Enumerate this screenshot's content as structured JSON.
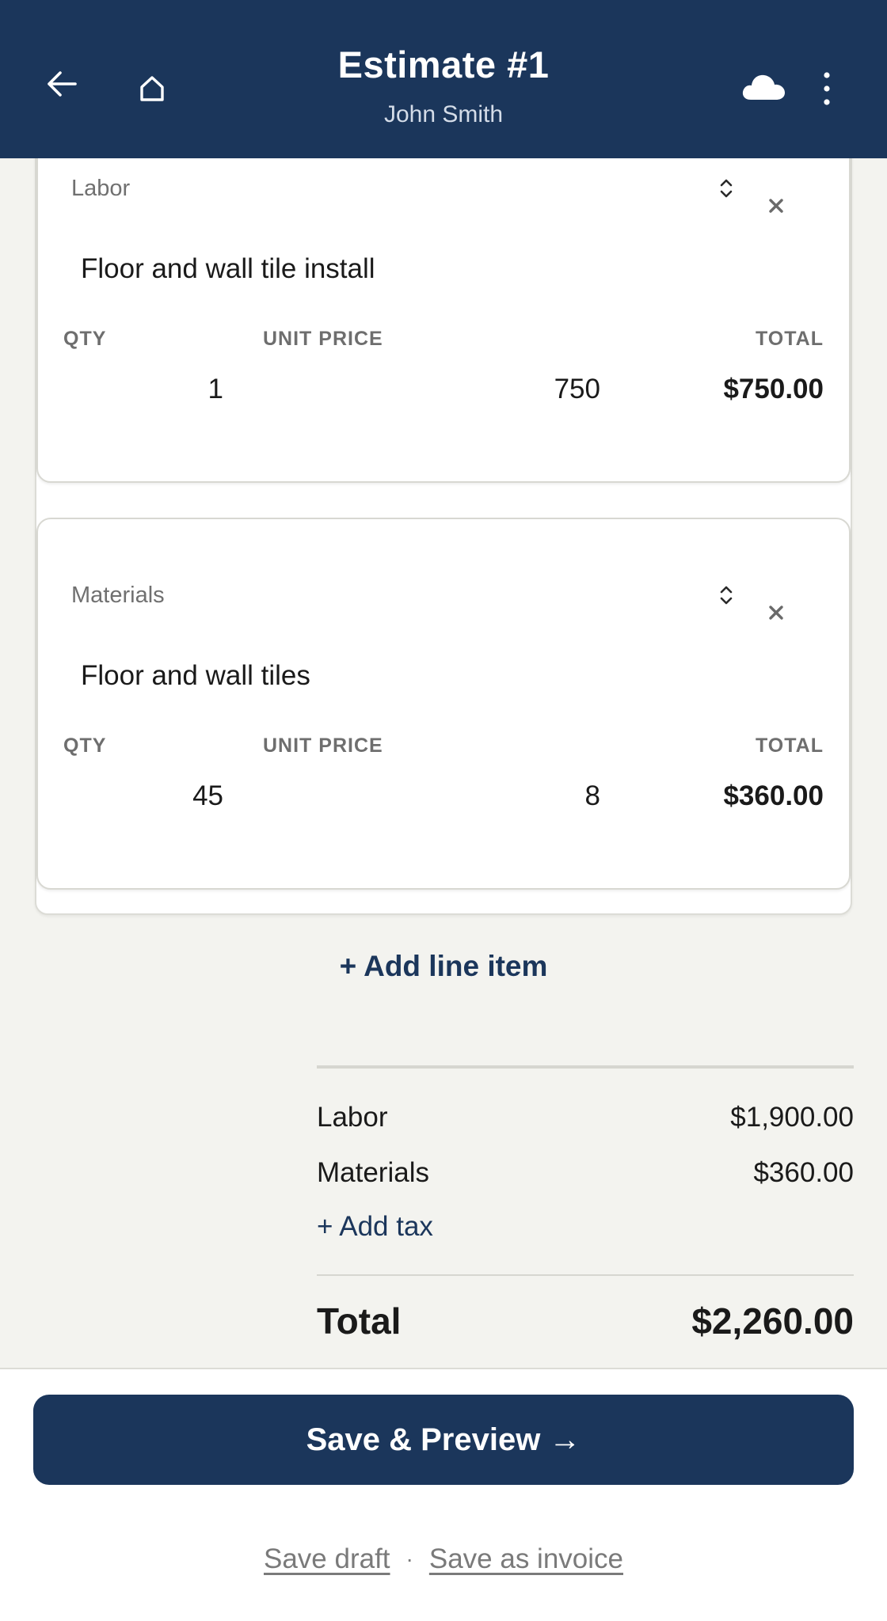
{
  "colors": {
    "header_bg": "#1b365b",
    "page_bg": "#f3f3ef",
    "accent": "#1b365b"
  },
  "header": {
    "title": "Estimate #1",
    "subtitle": "John Smith",
    "icons": [
      "back-arrow-icon",
      "home-icon",
      "cloud-icon",
      "more-vertical-icon"
    ]
  },
  "columns": {
    "qty": "QTY",
    "unit_price": "UNIT PRICE",
    "total": "TOTAL"
  },
  "line_items": [
    {
      "type": "Labor",
      "description": "Floor and wall tile install",
      "qty": "1",
      "unit_price": "750",
      "total": "$750.00"
    },
    {
      "type": "Materials",
      "description": "Floor and wall tiles",
      "qty": "45",
      "unit_price": "8",
      "total": "$360.00"
    }
  ],
  "add_line_item": "+ Add line item",
  "summary": {
    "labor_label": "Labor",
    "labor_value": "$1,900.00",
    "materials_label": "Materials",
    "materials_value": "$360.00",
    "add_tax": "+ Add tax",
    "total_label": "Total",
    "total_value": "$2,260.00"
  },
  "footer": {
    "primary_button": "Save & Preview →",
    "save_draft": "Save draft",
    "separator": "·",
    "save_as_invoice": "Save as invoice"
  }
}
